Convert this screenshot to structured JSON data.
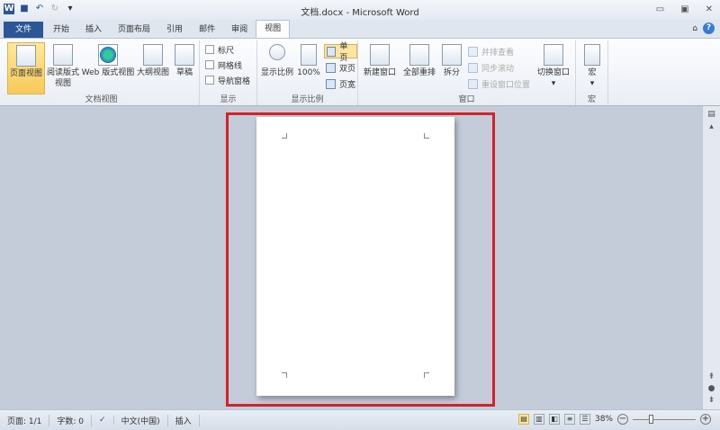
{
  "titlebar": {
    "title": "文档.docx - Microsoft Word",
    "qat": [
      "word-logo",
      "save",
      "undo",
      "redo",
      "customize"
    ]
  },
  "tabs": [
    "文件",
    "开始",
    "插入",
    "页面布局",
    "引用",
    "邮件",
    "审阅",
    "视图"
  ],
  "active_tab": "视图",
  "ribbon": {
    "doc_views": {
      "label": "文档视图",
      "items": [
        "页面视图",
        "阅读版式\n视图",
        "Web 版式视图",
        "大纲视图",
        "草稿"
      ]
    },
    "show": {
      "label": "显示",
      "items": [
        "标尺",
        "网格线",
        "导航窗格"
      ]
    },
    "zoom": {
      "label": "显示比例",
      "zoom_btn": "显示比例",
      "hundred": "100%",
      "one_page": "单页",
      "two_pages": "双页",
      "page_width": "页宽"
    },
    "window": {
      "label": "窗口",
      "new_window": "新建窗口",
      "arrange_all": "全部重排",
      "split": "拆分",
      "side_by_side": "并排查看",
      "sync_scroll": "同步滚动",
      "reset_pos": "重设窗口位置",
      "switch": "切换窗口"
    },
    "macros": {
      "label": "宏",
      "btn": "宏"
    }
  },
  "status": {
    "page": "页面: 1/1",
    "words": "字数: 0",
    "lang": "中文(中国)",
    "mode": "插入",
    "zoom": "38%"
  },
  "highlight_color": "#d2232a"
}
